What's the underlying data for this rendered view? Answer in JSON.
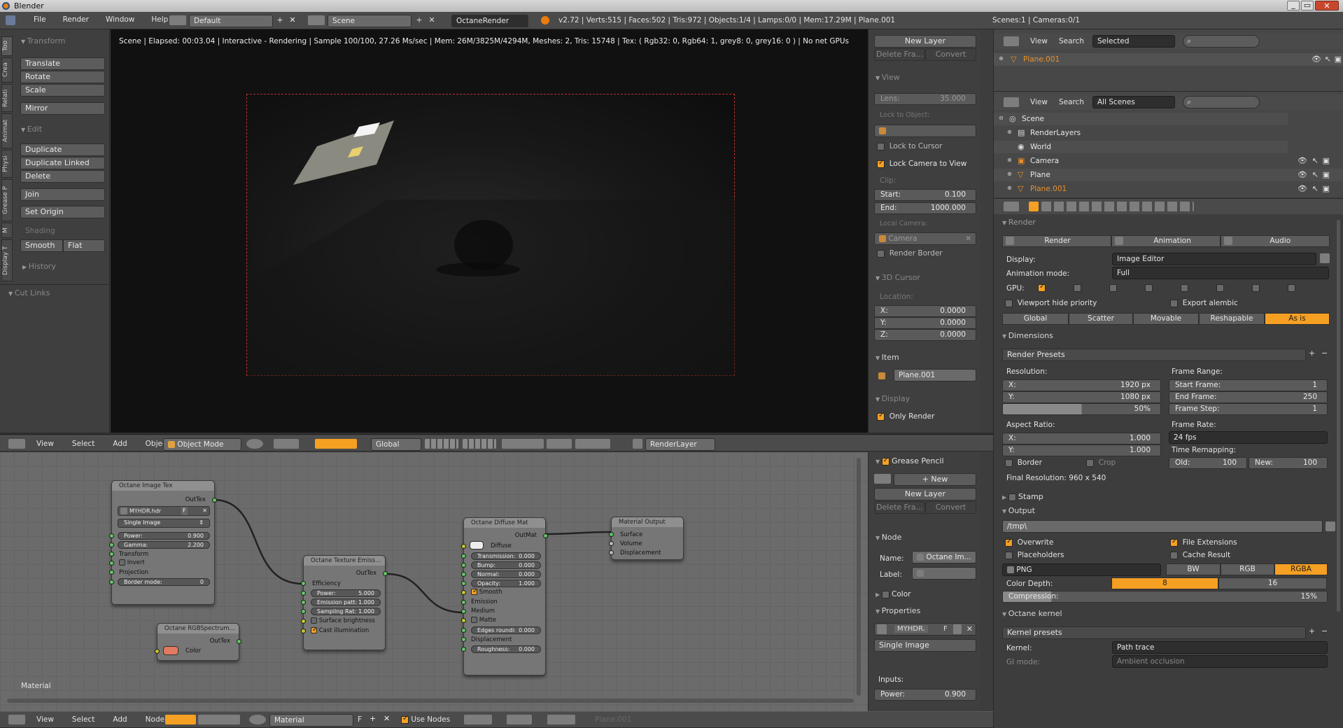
{
  "titlebar": {
    "app": "Blender"
  },
  "menu": [
    "File",
    "Render",
    "Window",
    "Help"
  ],
  "topbar": {
    "layout": "Default",
    "scene": "Scene",
    "engine": "OctaneRender",
    "stats": "v2.72 | Verts:515 | Faces:502 | Tris:972 | Objects:1/4 | Lamps:0/0 | Mem:17.29M | Plane.001",
    "scenes_info": "Scenes:1 | Cameras:0/1"
  },
  "toolshelf": {
    "tabs": [
      "Too",
      "Crea",
      "Relati",
      "Animat",
      "Physi",
      "Grease P",
      "M",
      "Display T"
    ],
    "transform_title": "Transform",
    "transform": [
      "Translate",
      "Rotate",
      "Scale"
    ],
    "mirror": "Mirror",
    "edit_title": "Edit",
    "edit": [
      "Duplicate",
      "Duplicate Linked",
      "Delete"
    ],
    "join": "Join",
    "set_origin": "Set Origin",
    "shading_title": "Shading",
    "smooth": "Smooth",
    "flat": "Flat",
    "history": "History",
    "cut_links": "Cut Links"
  },
  "viewport": {
    "status": "Scene | Elapsed: 00:03.04 | Interactive - Rendering | Sample 100/100, 27.26 Ms/sec | Mem: 26M/3825M/4294M, Meshes: 2, Tris: 15748 | Tex: ( Rgb32: 0, Rgb64: 1, grey8: 0, grey16: 0 ) | No net GPUs"
  },
  "npanel": {
    "new_layer": "New Layer",
    "delete_frame": "Delete Fra...",
    "convert": "Convert",
    "view": "View",
    "lens_label": "Lens:",
    "lens": "35.000",
    "lock_object": "Lock to Object:",
    "lock_cursor": "Lock to Cursor",
    "lock_camera": "Lock Camera to View",
    "clip": "Clip:",
    "start_label": "Start:",
    "start": "0.100",
    "end_label": "End:",
    "end": "1000.000",
    "local_camera": "Local Camera:",
    "camera": "Camera",
    "render_border": "Render Border",
    "cursor_title": "3D Cursor",
    "location": "Location:",
    "x_label": "X:",
    "x": "0.0000",
    "y_label": "Y:",
    "y": "0.0000",
    "z_label": "Z:",
    "z": "0.0000",
    "item": "Item",
    "item_name": "Plane.001",
    "display": "Display",
    "only_render": "Only Render"
  },
  "view3d_header": {
    "menus": [
      "View",
      "Select",
      "Add",
      "Object"
    ],
    "mode": "Object Mode",
    "orientation": "Global",
    "renderlayer": "RenderLayer"
  },
  "nodes": {
    "image_tex": {
      "title": "Octane Image Tex",
      "out": "OutTex",
      "file": "MYHDR.hdr",
      "file_f": "F",
      "type": "Single Image",
      "power_l": "Power:",
      "power": "0.900",
      "gamma_l": "Gamma:",
      "gamma": "2.200",
      "transform": "Transform",
      "invert": "Invert",
      "projection": "Projection",
      "border_l": "Border mode:",
      "border": "0"
    },
    "rgb": {
      "title": "Octane RGBSpectrum...",
      "out": "OutTex",
      "color": "Color",
      "swatch": "#e07a60"
    },
    "emission": {
      "title": "Octane Texture Emiss...",
      "out": "OutTex",
      "efficiency": "Efficiency",
      "power_l": "Power:",
      "power": "5.000",
      "patt_l": "Emission patt:",
      "patt": "1.000",
      "samp_l": "Sampling Rat:",
      "samp": "1.000",
      "surface": "Surface brightness",
      "cast": "Cast illumination"
    },
    "diffuse": {
      "title": "Octane Diffuse Mat",
      "out": "OutMat",
      "diffuse": "Diffuse",
      "trans_l": "Transmission:",
      "trans": "0.000",
      "bump_l": "Bump:",
      "bump": "0.000",
      "normal_l": "Normal:",
      "normal": "0.000",
      "opacity_l": "Opacity:",
      "opacity": "1.000",
      "smooth": "Smooth",
      "emission": "Emission",
      "medium": "Medium",
      "matte": "Matte",
      "edges_l": "Edges roundi:",
      "edges": "0.000",
      "displacement": "Displacement",
      "rough_l": "Roughness:",
      "rough": "0.000"
    },
    "output": {
      "title": "Material Output",
      "surface": "Surface",
      "volume": "Volume",
      "displacement": "Displacement"
    },
    "label": "Material"
  },
  "node_panel": {
    "grease": "Grease Pencil",
    "new": "New",
    "new_layer": "New Layer",
    "delete_frame": "Delete Fra...",
    "convert": "Convert",
    "node": "Node",
    "name_l": "Name:",
    "name": "Octane Im...",
    "label_l": "Label:",
    "color": "Color",
    "properties": "Properties",
    "img": "MYHDR.",
    "img_f": "F",
    "type": "Single Image",
    "inputs": "Inputs:",
    "power_l": "Power:",
    "power": "0.900"
  },
  "node_header": {
    "menus": [
      "View",
      "Select",
      "Add",
      "Node"
    ],
    "material": "Material",
    "f": "F",
    "use_nodes": "Use Nodes",
    "object": "Plane.001"
  },
  "outliner1": {
    "menus": [
      "View",
      "Search"
    ],
    "filter": "Selected",
    "item": "Plane.001"
  },
  "outliner2": {
    "menus": [
      "View",
      "Search"
    ],
    "filter": "All Scenes",
    "items": [
      "Scene",
      "RenderLayers",
      "World",
      "Camera",
      "Plane",
      "Plane.001"
    ]
  },
  "props": {
    "render_title": "Render",
    "render": "Render",
    "animation": "Animation",
    "audio": "Audio",
    "display_l": "Display:",
    "display": "Image Editor",
    "anim_l": "Animation mode:",
    "anim": "Full",
    "gpu_l": "GPU:",
    "viewport_hide": "Viewport hide priority",
    "export_alembic": "Export alembic",
    "modes": [
      "Global",
      "Scatter",
      "Movable",
      "Reshapable",
      "As is"
    ],
    "dimensions": "Dimensions",
    "render_presets": "Render Presets",
    "resolution": "Resolution:",
    "res_x": "1920 px",
    "res_y": "1080 px",
    "res_pct": "50%",
    "res_pct_value": 0.5,
    "frame_range": "Frame Range:",
    "start_frame_l": "Start Frame:",
    "start_frame": "1",
    "end_frame_l": "End Frame:",
    "end_frame": "250",
    "frame_step_l": "Frame Step:",
    "frame_step": "1",
    "aspect": "Aspect Ratio:",
    "asp_x": "1.000",
    "asp_y": "1.000",
    "frame_rate": "Frame Rate:",
    "fps": "24 fps",
    "time_remap": "Time Remapping:",
    "old_l": "Old:",
    "old": "100",
    "new_l": "New:",
    "new": "100",
    "border": "Border",
    "crop": "Crop",
    "final_res": "Final Resolution: 960 x 540",
    "stamp": "Stamp",
    "output": "Output",
    "path": "/tmp\\",
    "overwrite": "Overwrite",
    "file_ext": "File Extensions",
    "placeholders": "Placeholders",
    "cache": "Cache Result",
    "format": "PNG",
    "bw": "BW",
    "rgb": "RGB",
    "rgba": "RGBA",
    "color_depth": "Color Depth:",
    "depth8": "8",
    "depth16": "16",
    "compression_l": "Compression:",
    "compression": "15%",
    "compression_value": 0.15,
    "kernel_title": "Octane kernel",
    "kernel_presets": "Kernel presets",
    "kernel_l": "Kernel:",
    "kernel": "Path trace",
    "ao": "Ambient occlusion",
    "gi_l": "GI mode:"
  },
  "colors": {
    "accent": "#f5a023",
    "selected_text": "#e8902a",
    "panel": "#3d3d3d",
    "viewport": "#121212"
  }
}
